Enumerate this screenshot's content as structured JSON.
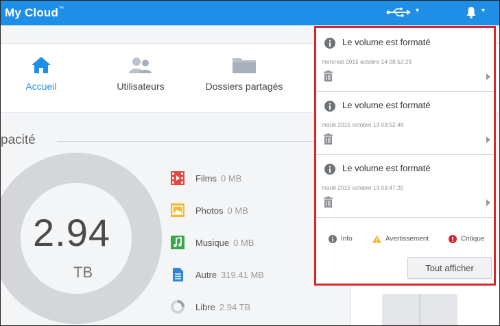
{
  "header": {
    "brand": "My Cloud",
    "brand_tm": "™"
  },
  "nav": [
    {
      "label": "Accueil",
      "icon": "home-icon",
      "active": true
    },
    {
      "label": "Utilisateurs",
      "icon": "users-icon"
    },
    {
      "label": "Dossiers partagés",
      "icon": "folder-icon"
    }
  ],
  "capacity": {
    "label_visible": "pacité",
    "total": "2.94",
    "unit": "TB",
    "legend": [
      {
        "label": "Films",
        "value": "0 MB",
        "color": "#e9463f",
        "icon": "film-icon"
      },
      {
        "label": "Photos",
        "value": "0 MB",
        "color": "#f5b82e",
        "icon": "photo-icon"
      },
      {
        "label": "Musique",
        "value": "0 MB",
        "color": "#3aa64c",
        "icon": "music-icon"
      },
      {
        "label": "Autre",
        "value": "319.41 MB",
        "color": "#2f86d8",
        "icon": "file-icon"
      },
      {
        "label": "Libre",
        "value": "2.94 TB",
        "color": "#cfd2d6",
        "icon": "free-space-icon"
      }
    ]
  },
  "notifications": {
    "items": [
      {
        "title": "Le volume est formaté",
        "date": "mercredi 2015 octobre 14 08:52:29"
      },
      {
        "title": "Le volume est formaté",
        "date": "mardi 2015 octobre 13 03:52:48"
      },
      {
        "title": "Le volume est formaté",
        "date": "mardi 2015 octobre 13 03:47:20"
      }
    ],
    "legend": {
      "info": "Info",
      "warning": "Avertissement",
      "critical": "Critique"
    },
    "show_all": "Tout afficher"
  },
  "colors": {
    "topbar": "#1f8ee6",
    "panel_border": "#d9242c",
    "accent": "#1f8ee6"
  }
}
